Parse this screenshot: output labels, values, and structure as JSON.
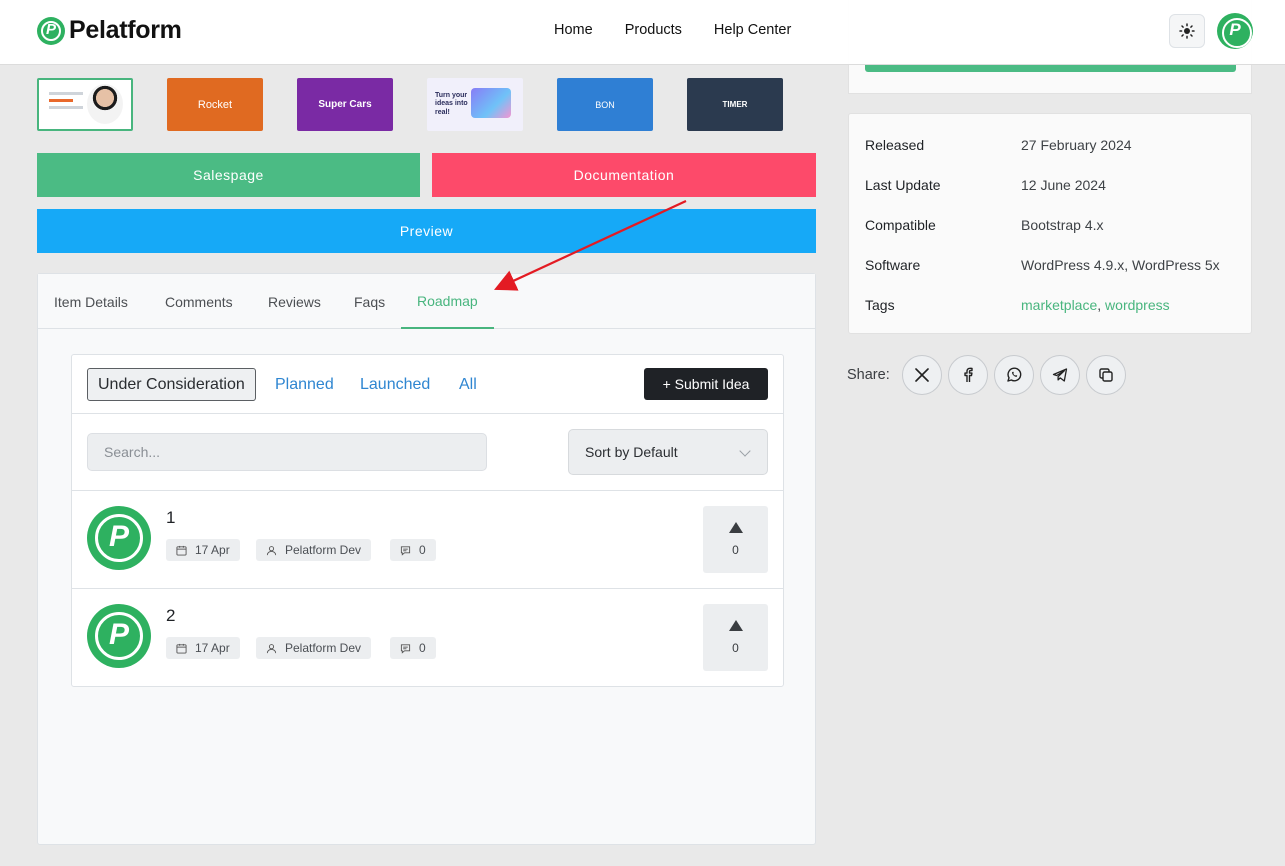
{
  "header": {
    "logo_text": "Pelatform",
    "logo_letter": "P",
    "nav": [
      "Home",
      "Products",
      "Help Center"
    ]
  },
  "thumbnails": [
    {
      "label": "",
      "icon": "hero-person-thumbnail"
    },
    {
      "label": "Rocket"
    },
    {
      "label": "Super Cars"
    },
    {
      "label": "Turn your ideas into real!"
    },
    {
      "label": "BON"
    },
    {
      "label": "TIMER"
    }
  ],
  "buttons": {
    "salespage": "Salespage",
    "documentation": "Documentation",
    "preview": "Preview"
  },
  "tabs": [
    "Item Details",
    "Comments",
    "Reviews",
    "Faqs",
    "Roadmap"
  ],
  "active_tab": "Roadmap",
  "roadmap": {
    "filters": [
      "Under Consideration",
      "Planned",
      "Launched",
      "All"
    ],
    "submit_label": "+ Submit Idea",
    "search_placeholder": "Search...",
    "sort_label": "Sort by Default",
    "ideas": [
      {
        "title": "1",
        "date": "17 Apr",
        "author": "Pelatform Dev",
        "comments": "0",
        "votes": "0"
      },
      {
        "title": "2",
        "date": "17 Apr",
        "author": "Pelatform Dev",
        "comments": "0",
        "votes": "0"
      }
    ]
  },
  "info": {
    "rows": [
      {
        "key": "Released",
        "value": "27 February 2024"
      },
      {
        "key": "Last Update",
        "value": "12 June 2024"
      },
      {
        "key": "Compatible",
        "value": "Bootstrap 4.x"
      },
      {
        "key": "Software",
        "value": "WordPress 4.9.x, WordPress 5x"
      }
    ],
    "tags_label": "Tags",
    "tags": [
      "marketplace",
      "wordpress"
    ],
    "tags_separator": ", "
  },
  "share": {
    "label": "Share:",
    "icons": [
      "x-icon",
      "facebook-icon",
      "whatsapp-icon",
      "telegram-icon",
      "copy-icon"
    ]
  },
  "colors": {
    "brand_green": "#2eb160",
    "salespage": "#4bbb84",
    "documentation": "#fd4a6a",
    "preview": "#16a9f7",
    "annotation_arrow": "#e31b23"
  }
}
